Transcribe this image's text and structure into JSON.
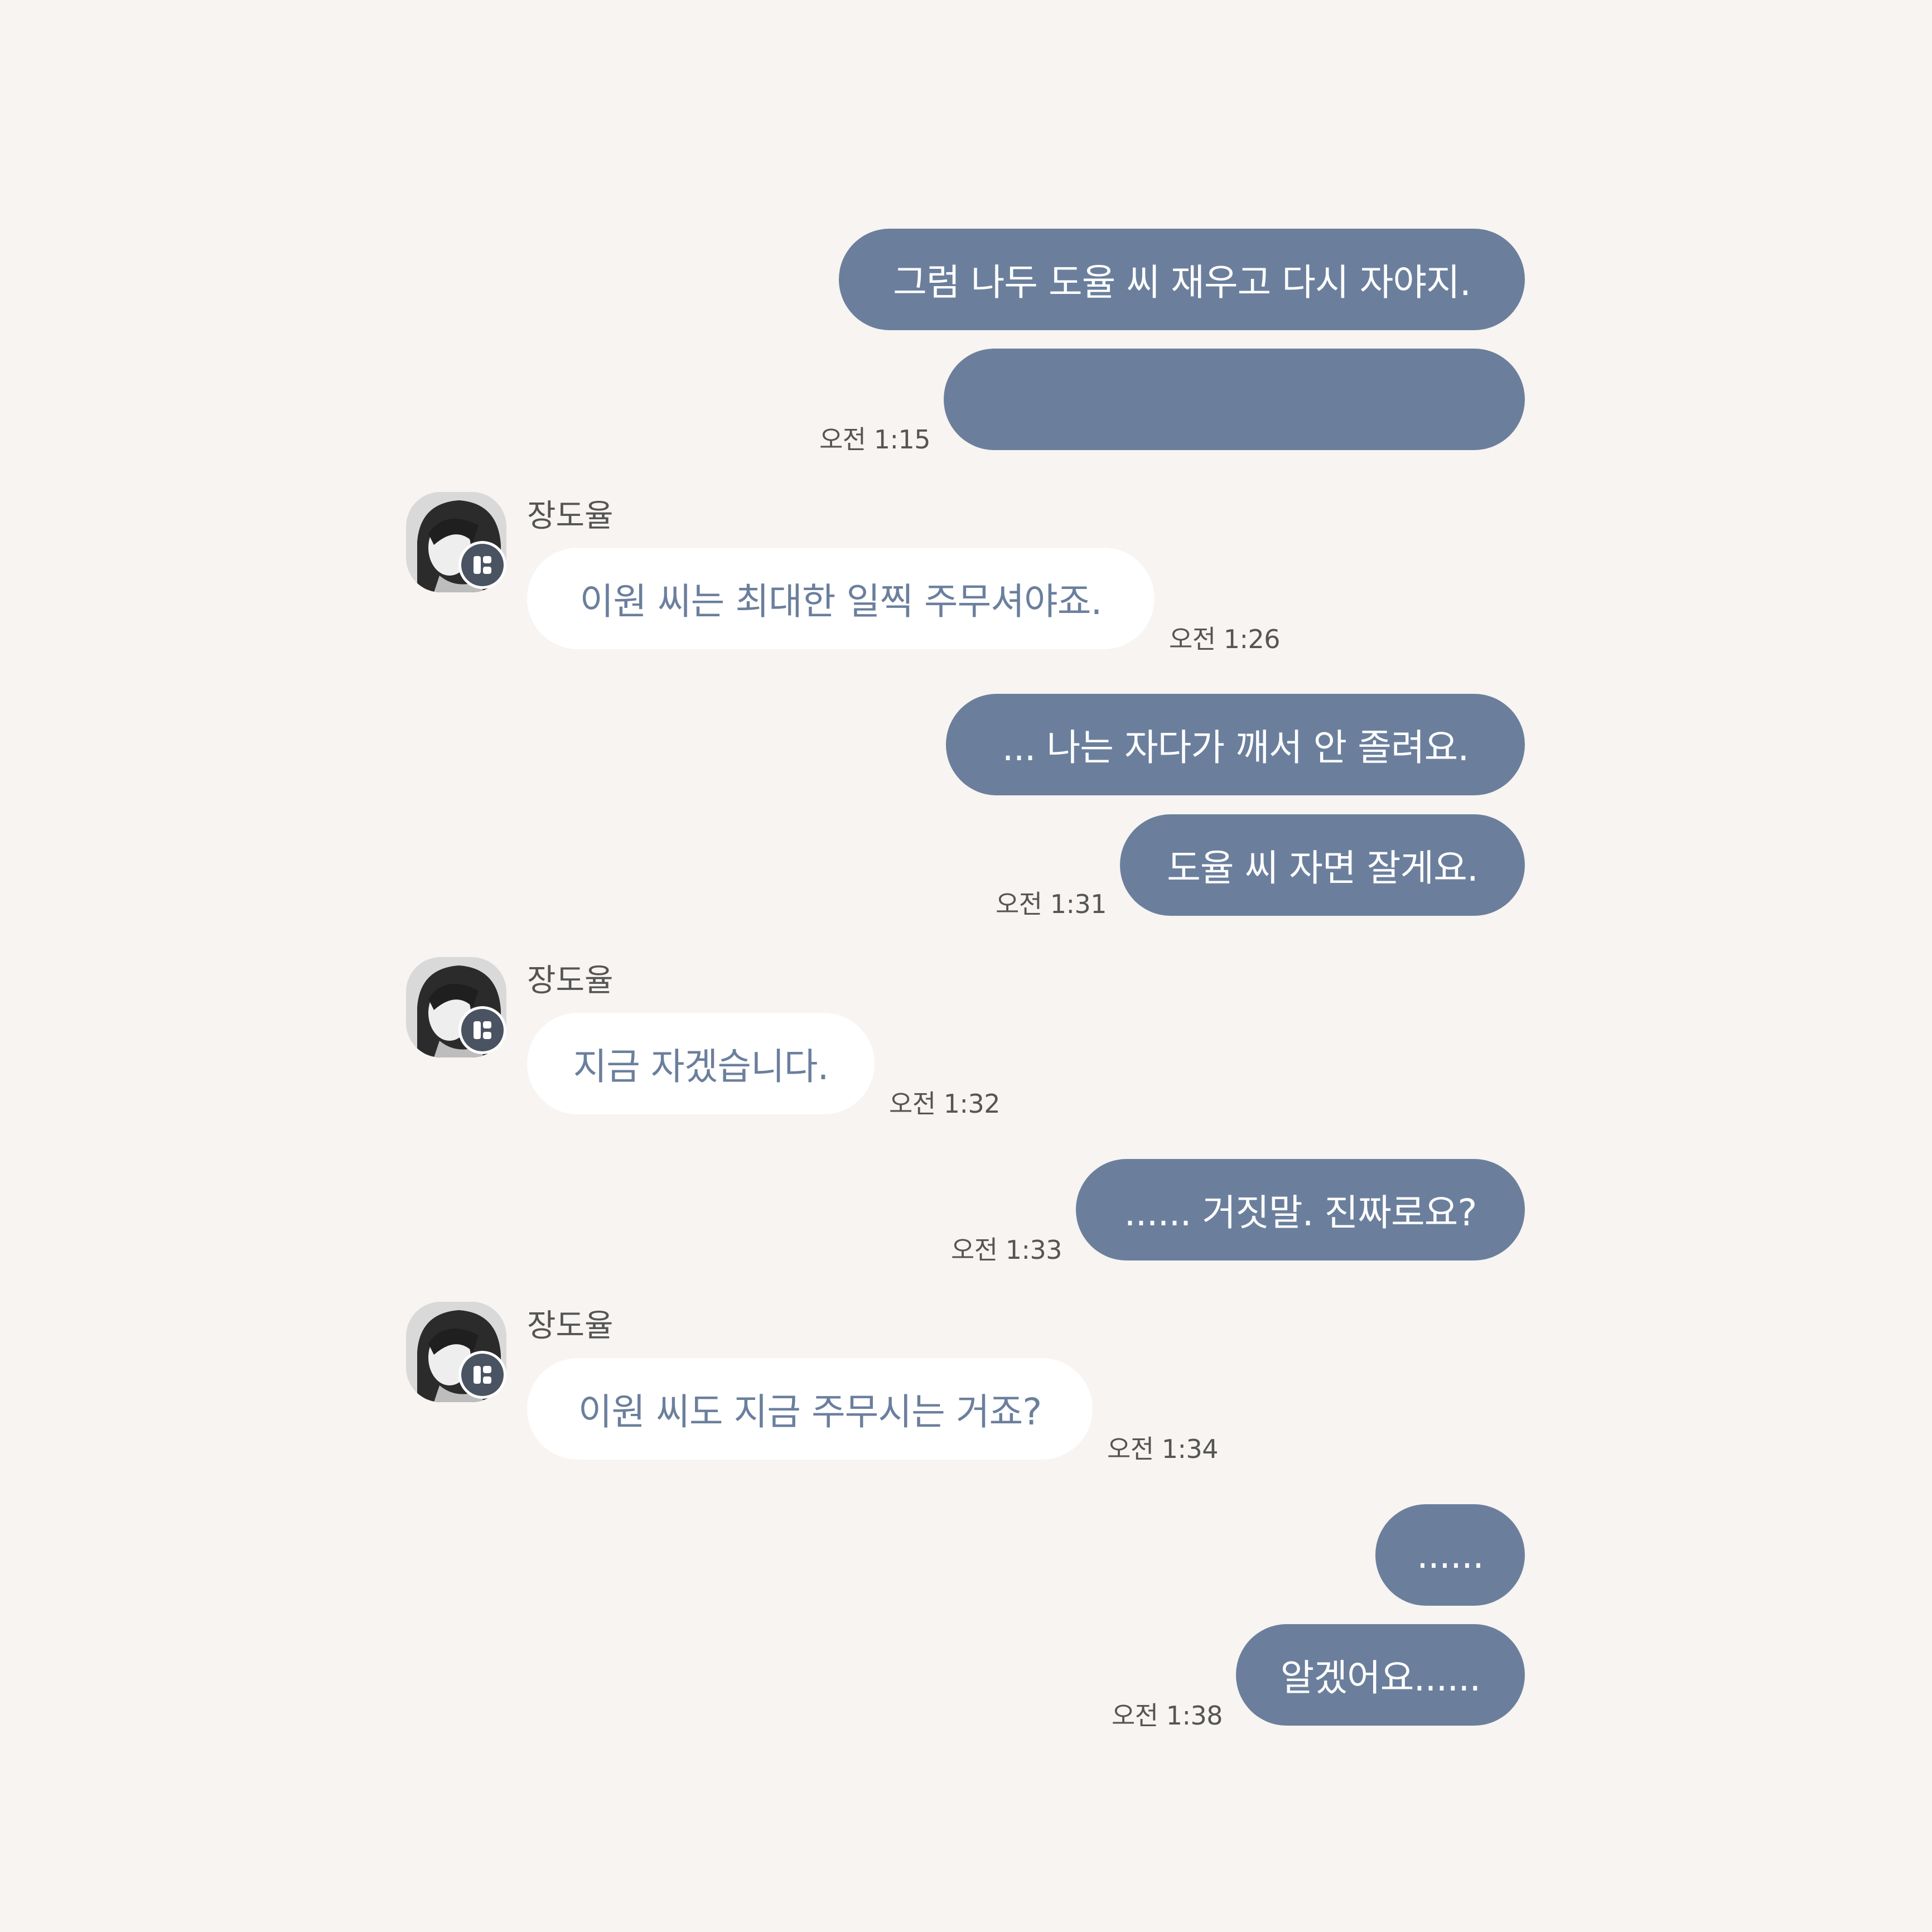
{
  "colors": {
    "background": "#f7f4f1",
    "outgoing_bubble": "#6b7f9d",
    "outgoing_text": "#ffffff",
    "incoming_bubble": "#ffffff",
    "incoming_text": "#6b7f9d",
    "timestamp": "#555555"
  },
  "sender_name": "장도율",
  "avatar_icon": "profile-photo-icon",
  "badge_icon": "channel-badge-icon",
  "messages": [
    {
      "direction": "outgoing",
      "text": "그럼 나두 도율 씨 재우고 다시 자야지."
    },
    {
      "direction": "outgoing",
      "text": "",
      "time": "오전 1:15"
    },
    {
      "direction": "incoming",
      "sender": "장도율",
      "text": "이원 씨는 최대한 일찍 주무셔야죠.",
      "time": "오전 1:26"
    },
    {
      "direction": "outgoing",
      "text": "... 나는 자다가 깨서 안 졸려요."
    },
    {
      "direction": "outgoing",
      "text": "도율 씨 자면 잘게요.",
      "time": "오전 1:31"
    },
    {
      "direction": "incoming",
      "sender": "장도율",
      "text": "지금 자겠습니다.",
      "time": "오전 1:32"
    },
    {
      "direction": "outgoing",
      "text": "...... 거짓말. 진짜로요?",
      "time": "오전 1:33"
    },
    {
      "direction": "incoming",
      "sender": "장도율",
      "text": "이원 씨도 지금 주무시는 거죠?",
      "time": "오전 1:34"
    },
    {
      "direction": "outgoing",
      "text": "......"
    },
    {
      "direction": "outgoing",
      "text": "알겠어요......",
      "time": "오전 1:38"
    }
  ]
}
